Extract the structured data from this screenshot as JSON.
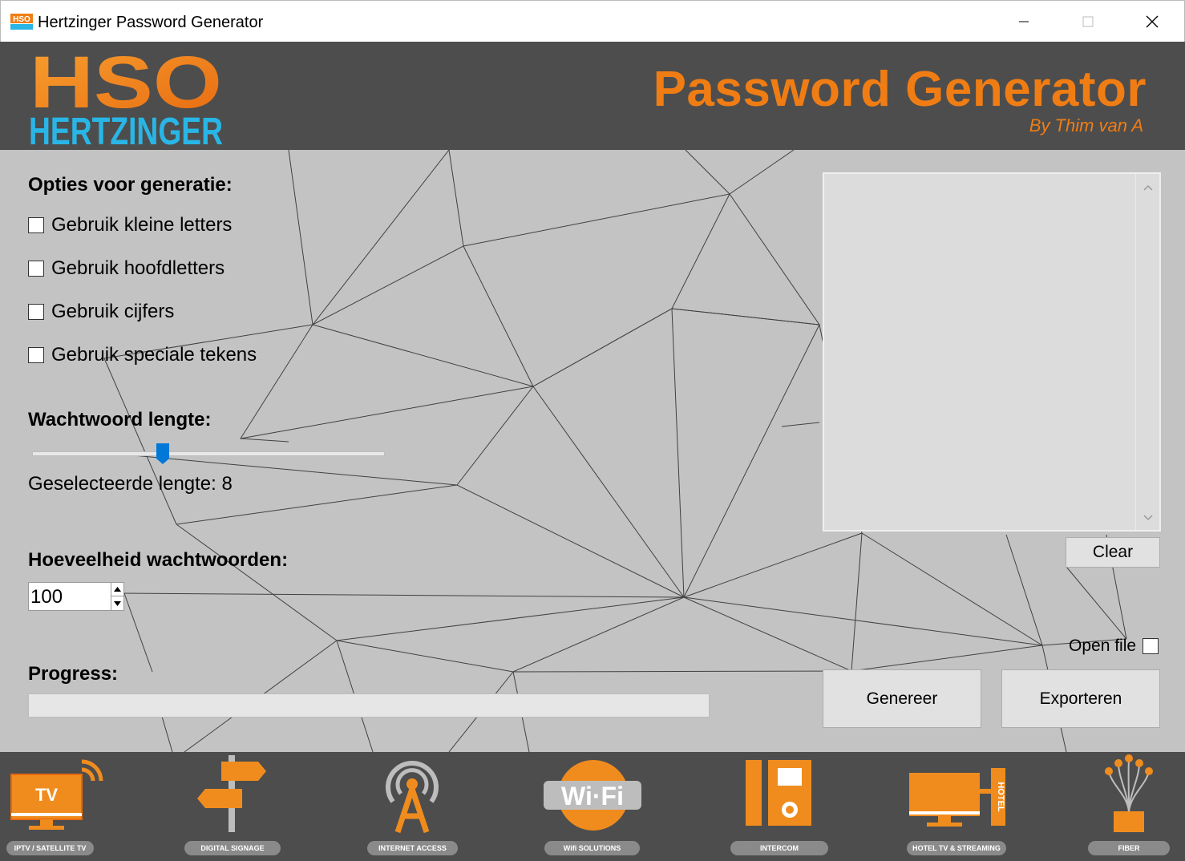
{
  "window": {
    "title": "Hertzinger Password Generator",
    "app_icon": "hso-logo-icon",
    "controls": [
      "minimize-icon",
      "maximize-icon",
      "close-icon"
    ]
  },
  "header": {
    "logo_top": "HSO",
    "logo_bottom": "HERTZINGER",
    "title": "Password Generator",
    "by_line": "By Thim van A",
    "accent_color": "#f07d14",
    "logo_blue": "#29b6e6"
  },
  "options": {
    "heading": "Opties voor generatie:",
    "items": [
      {
        "label": "Gebruik kleine letters",
        "checked": false
      },
      {
        "label": "Gebruik hoofdletters",
        "checked": false
      },
      {
        "label": "Gebruik cijfers",
        "checked": false
      },
      {
        "label": "Gebruik speciale tekens",
        "checked": false
      }
    ]
  },
  "length": {
    "heading": "Wachtwoord lengte:",
    "selected_text": "Geselecteerde lengte: 8",
    "slider_fraction": 0.37
  },
  "quantity": {
    "heading": "Hoeveelheid wachtwoorden:",
    "value": "100"
  },
  "progress": {
    "heading": "Progress:",
    "value_percent": 0
  },
  "output": {
    "text": ""
  },
  "buttons": {
    "clear": "Clear",
    "generate": "Genereer",
    "export": "Exporteren"
  },
  "open_file": {
    "label": "Open file",
    "checked": false
  },
  "footer": {
    "services": [
      {
        "label": "IPTV / SATELLITE TV",
        "icon": "tv-icon",
        "badge": "TV"
      },
      {
        "label": "DIGITAL SIGNAGE",
        "icon": "signpost-icon"
      },
      {
        "label": "INTERNET ACCESS",
        "icon": "antenna-tower-icon"
      },
      {
        "label": "Wifi SOLUTIONS",
        "icon": "wifi-icon",
        "badge": "Wi·Fi"
      },
      {
        "label": "INTERCOM",
        "icon": "intercom-icon"
      },
      {
        "label": "HOTEL TV & STREAMING",
        "icon": "hotel-tv-icon",
        "badge": "HOTEL"
      },
      {
        "label": "FIBER",
        "icon": "fiber-icon"
      }
    ]
  }
}
